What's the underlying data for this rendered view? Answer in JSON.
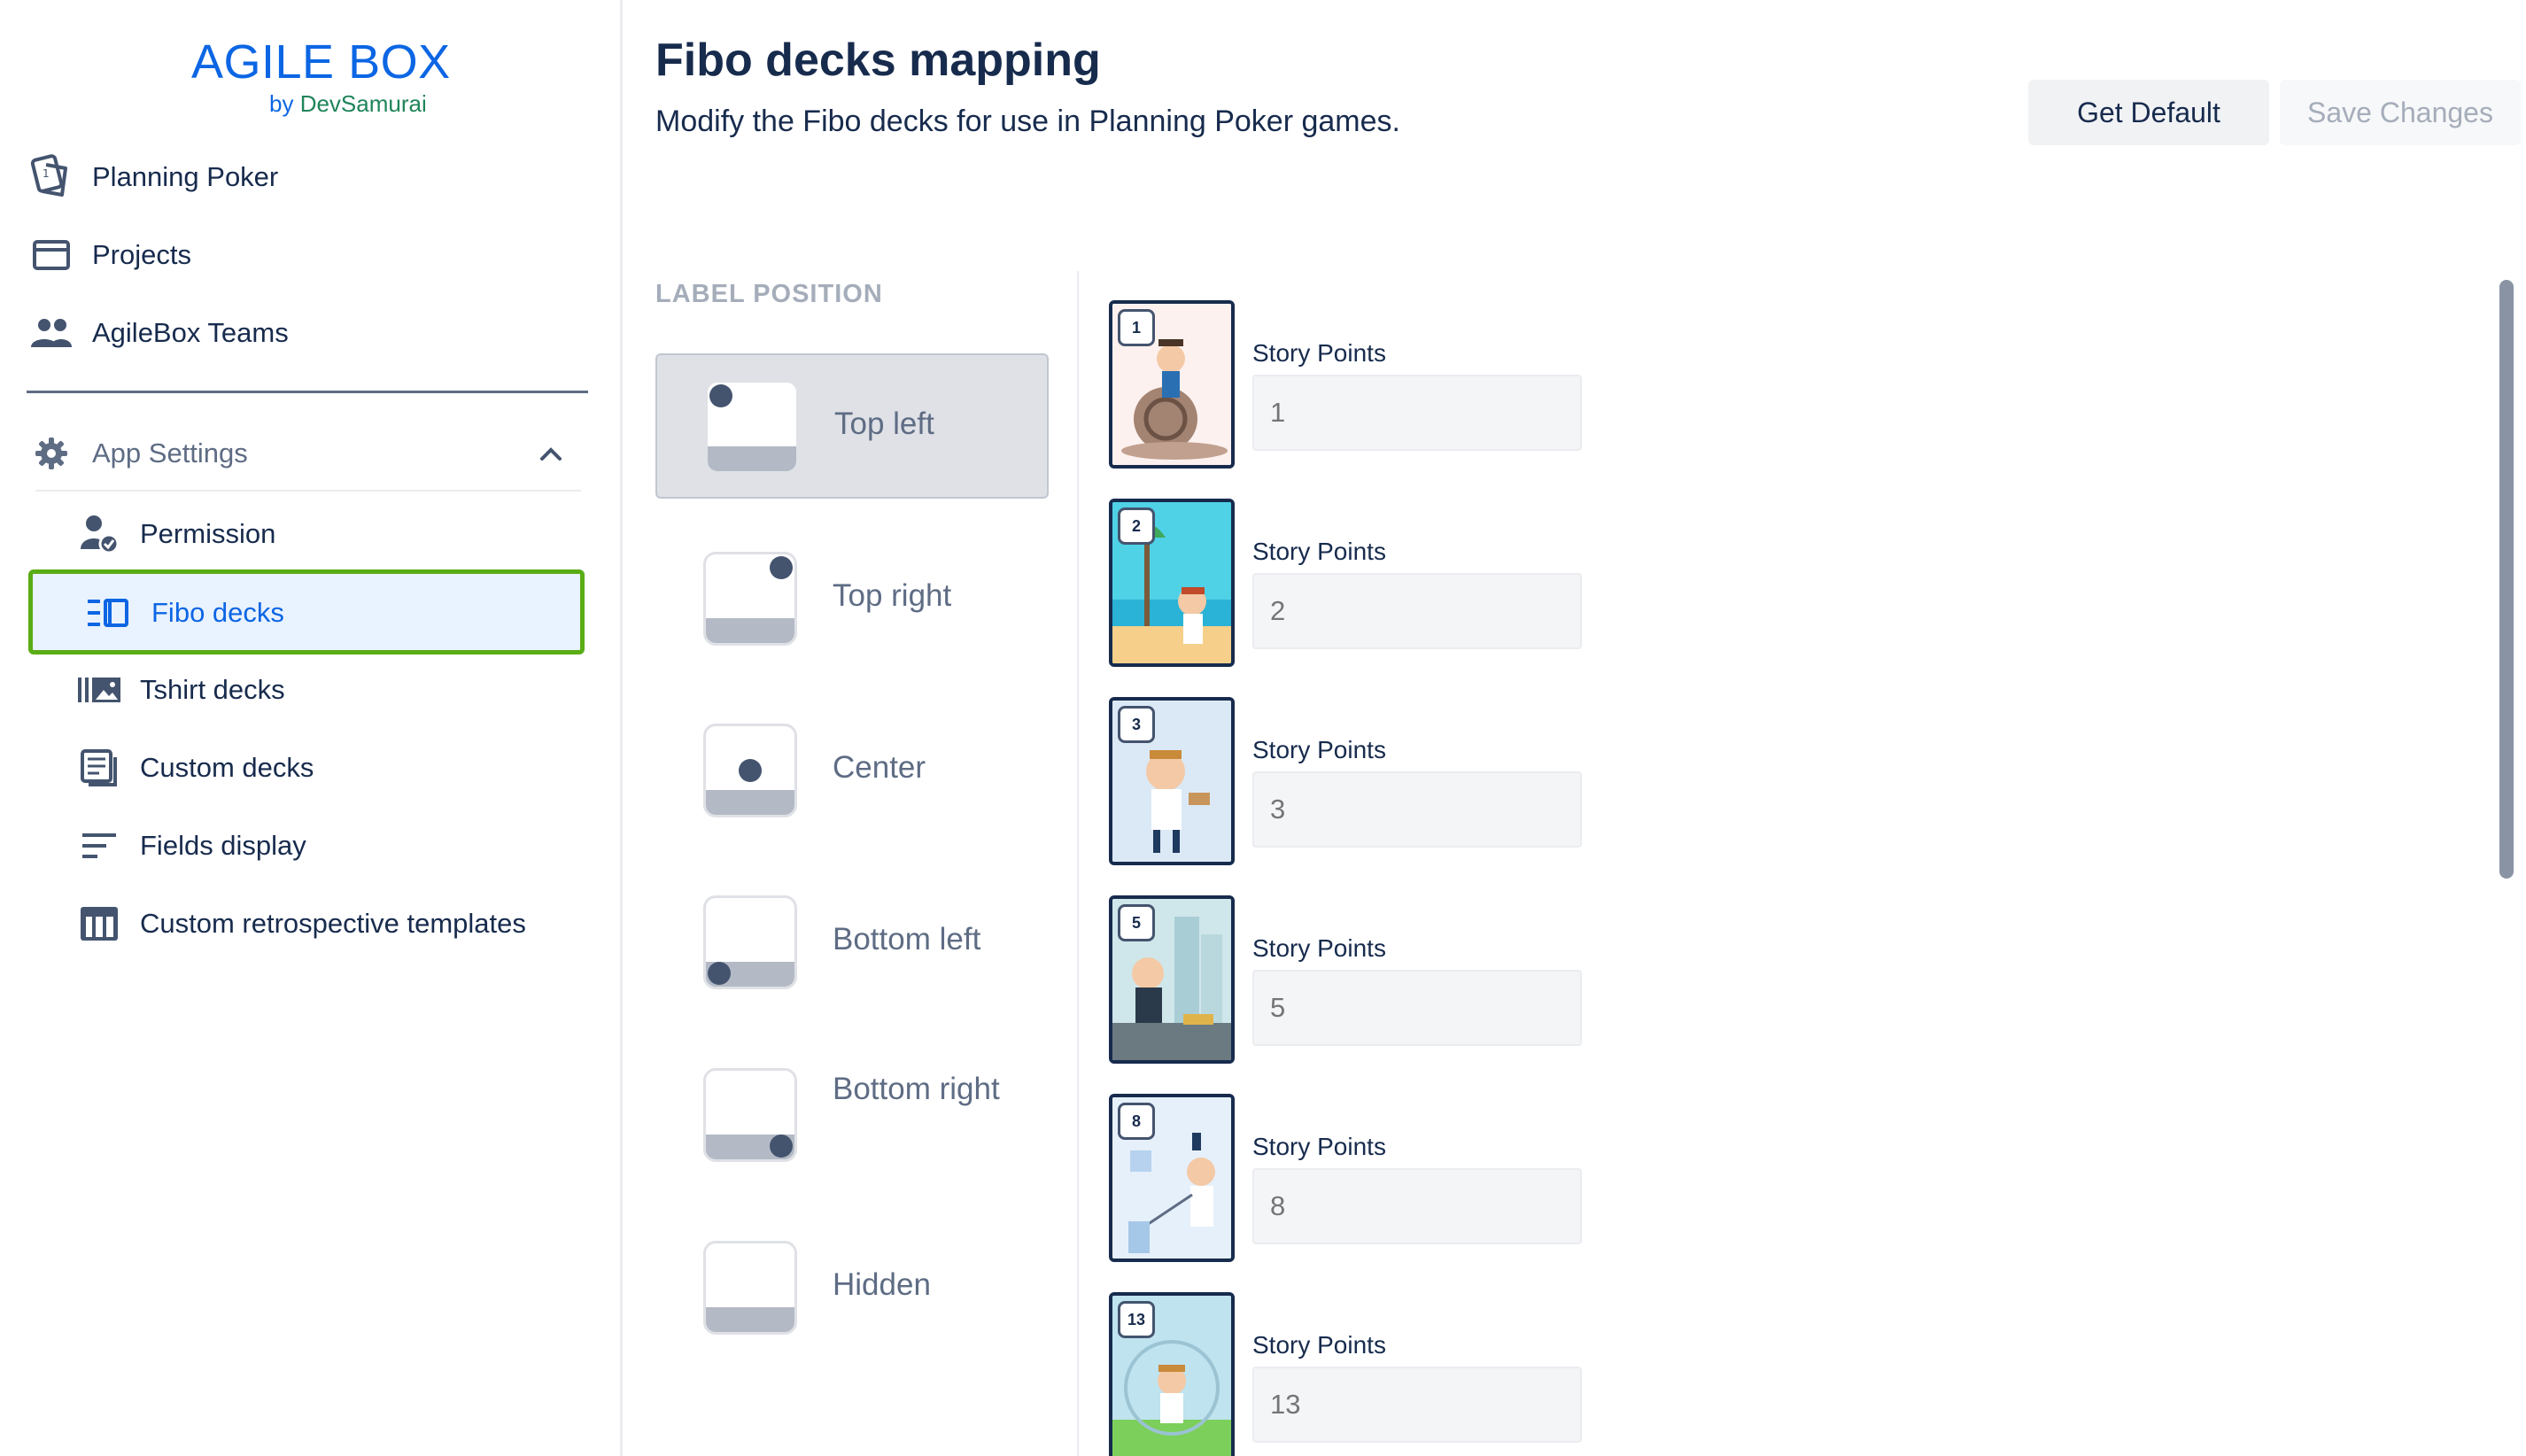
{
  "brand": {
    "title": "AGILE BOX",
    "by": "by ",
    "company": "DevSamurai"
  },
  "sidebar": {
    "top_items": [
      {
        "label": "Planning Poker",
        "icon": "cards-icon"
      },
      {
        "label": "Projects",
        "icon": "folder-icon"
      },
      {
        "label": "AgileBox Teams",
        "icon": "team-icon"
      }
    ],
    "settings": {
      "label": "App Settings",
      "icon": "gear-icon",
      "expanded": true
    },
    "sub_items": [
      {
        "label": "Permission",
        "icon": "user-check-icon"
      },
      {
        "label": "Fibo decks",
        "icon": "fibo-deck-icon",
        "active": true
      },
      {
        "label": "Tshirt decks",
        "icon": "tshirt-deck-icon"
      },
      {
        "label": "Custom decks",
        "icon": "custom-deck-icon"
      },
      {
        "label": "Fields display",
        "icon": "fields-icon"
      },
      {
        "label": "Custom retrospective templates",
        "icon": "table-icon"
      }
    ]
  },
  "header": {
    "title": "Fibo decks mapping",
    "description": "Modify the Fibo decks for use in Planning Poker games.",
    "get_default_label": "Get Default",
    "save_label": "Save Changes"
  },
  "label_position": {
    "heading": "LABEL POSITION",
    "selected": "Top left",
    "options": [
      "Top left",
      "Top right",
      "Center",
      "Bottom left",
      "Bottom right",
      "Hidden"
    ]
  },
  "cards": [
    {
      "badge": "1",
      "field_label": "Story Points",
      "placeholder": "1"
    },
    {
      "badge": "2",
      "field_label": "Story Points",
      "placeholder": "2"
    },
    {
      "badge": "3",
      "field_label": "Story Points",
      "placeholder": "3"
    },
    {
      "badge": "5",
      "field_label": "Story Points",
      "placeholder": "5"
    },
    {
      "badge": "8",
      "field_label": "Story Points",
      "placeholder": "8"
    },
    {
      "badge": "13",
      "field_label": "Story Points",
      "placeholder": "13"
    }
  ],
  "colors": {
    "brand": "#0c66e4",
    "brand_sub": "#1f845a",
    "active_border": "#5aac14",
    "active_bg": "#e9f2ff"
  }
}
